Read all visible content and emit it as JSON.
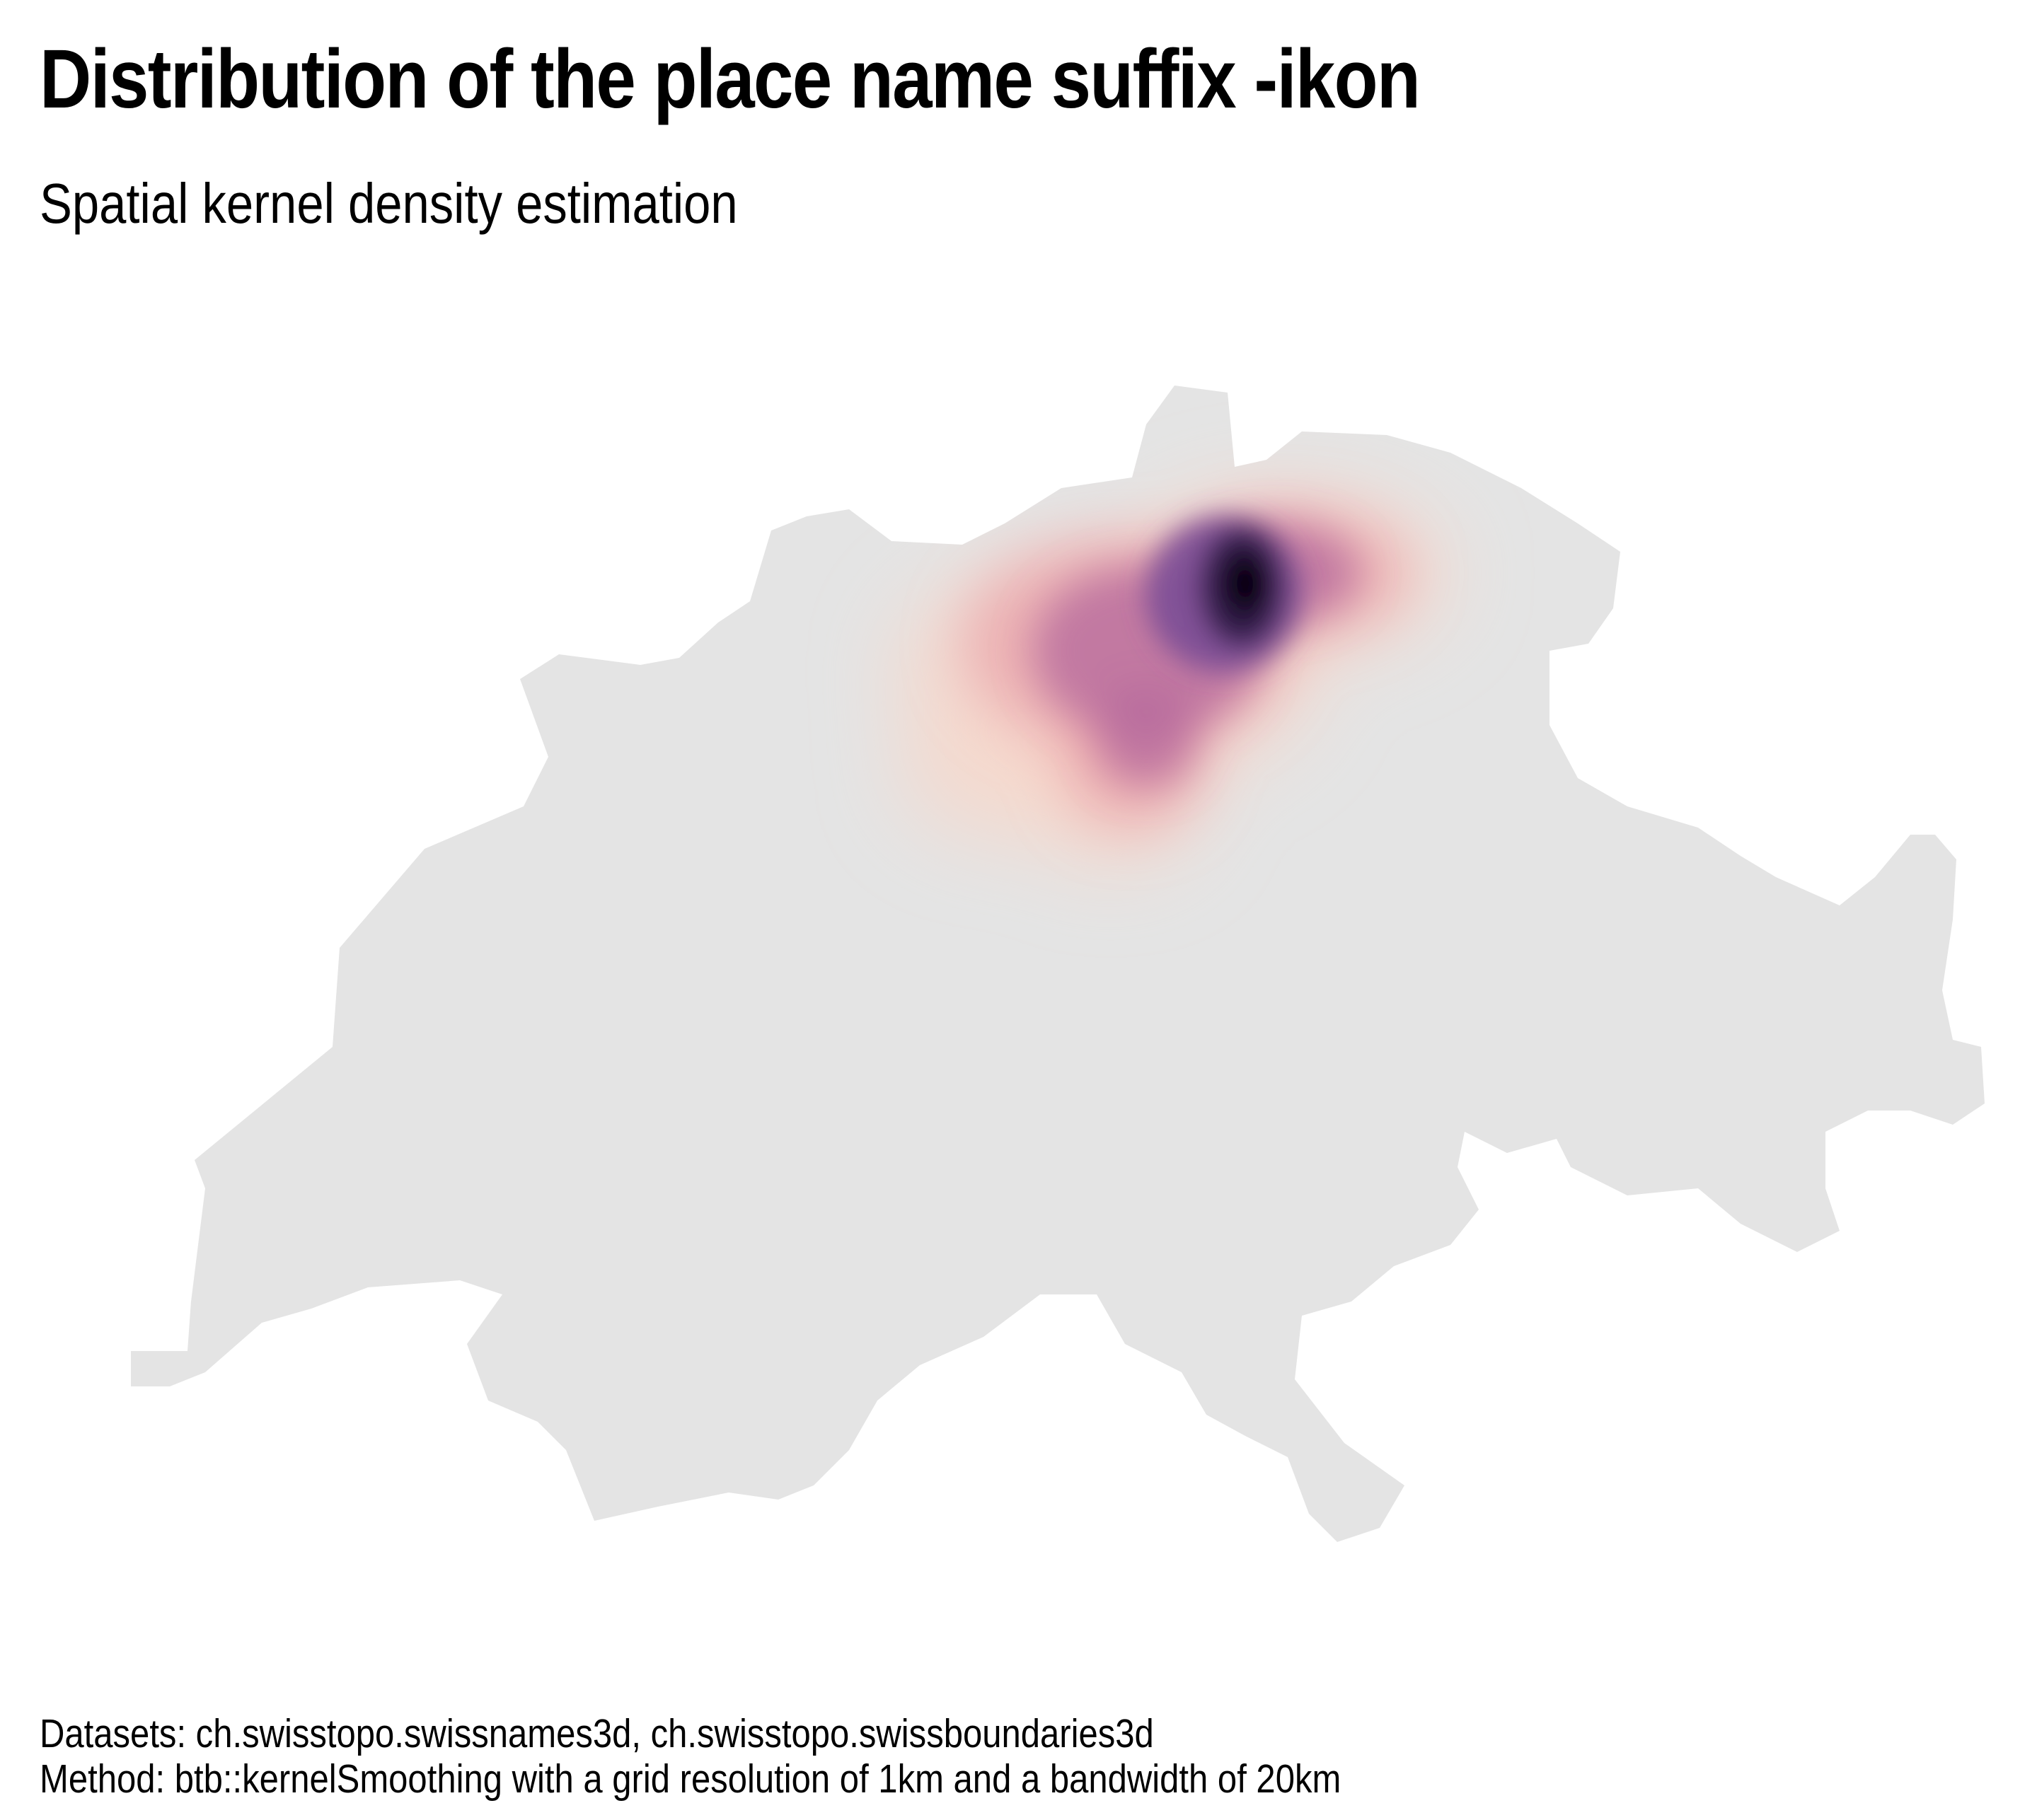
{
  "title": "Distribution of the place name suffix -ikon",
  "subtitle": "Spatial kernel density estimation",
  "caption": {
    "datasets": "Datasets: ch.swisstopo.swissnames3d, ch.swisstopo.swissboundaries3d",
    "method": "Method: btb::kernelSmoothing with a grid resolution of 1km and a bandwidth of 20km"
  },
  "map": {
    "country_fill": "#e4e4e4",
    "density_colors": [
      "#f6d8cc",
      "#e9a1a8",
      "#b86c9e",
      "#7a4c96",
      "#2e1a45",
      "#000000"
    ]
  }
}
